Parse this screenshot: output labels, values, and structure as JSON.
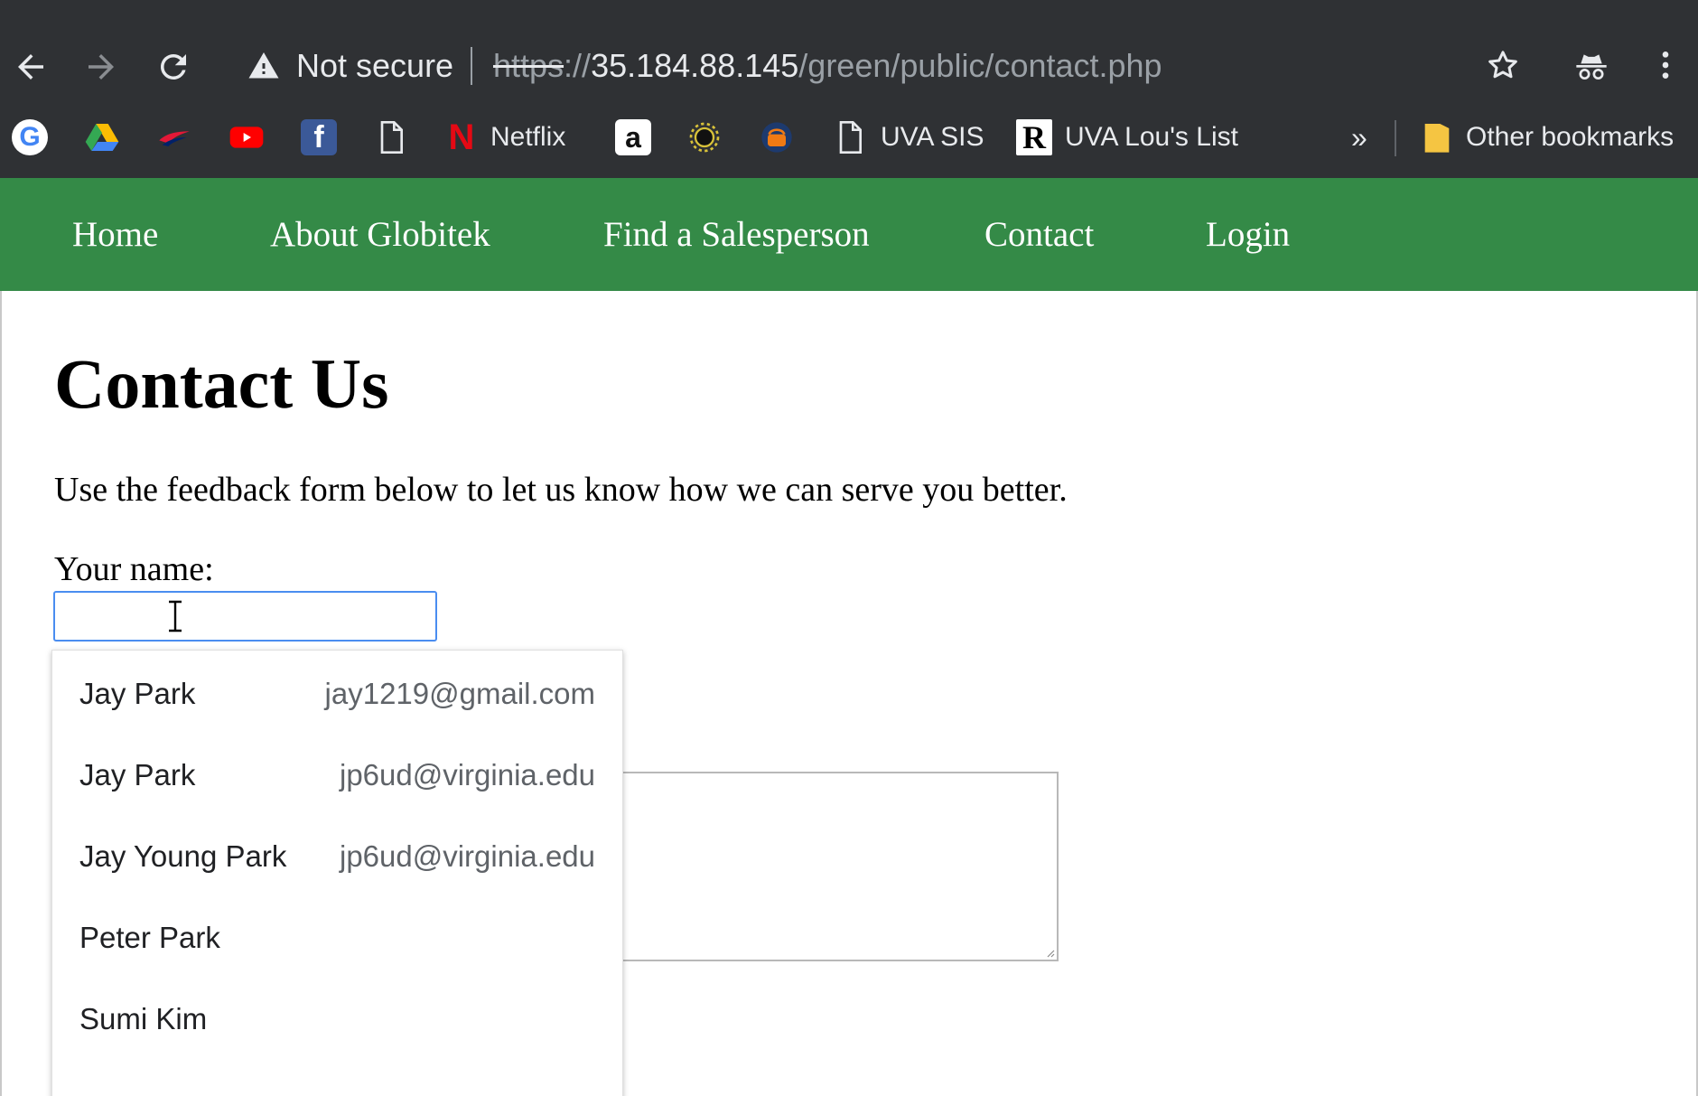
{
  "browser": {
    "security_text": "Not secure",
    "url_scheme": "https",
    "url_sep": "://",
    "url_host": "35.184.88.145",
    "url_path": "/green/public/contact.php",
    "bookmarks": [
      {
        "name": "google",
        "label": ""
      },
      {
        "name": "drive",
        "label": ""
      },
      {
        "name": "bank-of-america",
        "label": ""
      },
      {
        "name": "youtube",
        "label": ""
      },
      {
        "name": "facebook",
        "label": ""
      },
      {
        "name": "page",
        "label": ""
      },
      {
        "name": "netflix",
        "label": "Netflix"
      },
      {
        "name": "amazon",
        "label": ""
      },
      {
        "name": "sun",
        "label": ""
      },
      {
        "name": "basket",
        "label": ""
      },
      {
        "name": "uva-sis",
        "label": "UVA SIS"
      },
      {
        "name": "uva-lous-list",
        "label": "UVA Lou's List"
      }
    ],
    "overflow_label": "»",
    "other_bookmarks_label": "Other bookmarks"
  },
  "nav": {
    "items": [
      "Home",
      "About Globitek",
      "Find a Salesperson",
      "Contact",
      "Login"
    ]
  },
  "page": {
    "title": "Contact Us",
    "intro": "Use the feedback form below to let us know how we can serve you better.",
    "name_label": "Your name:",
    "name_value": ""
  },
  "autofill": {
    "items": [
      {
        "name": "Jay Park",
        "email": "jay1219@gmail.com"
      },
      {
        "name": "Jay Park",
        "email": "jp6ud@virginia.edu"
      },
      {
        "name": "Jay Young Park",
        "email": "jp6ud@virginia.edu"
      },
      {
        "name": "Peter Park",
        "email": ""
      },
      {
        "name": "Sumi Kim",
        "email": ""
      }
    ]
  },
  "colors": {
    "chrome_bg": "#2f3134",
    "nav_green": "#348a47",
    "focus_blue": "#4a8df0"
  }
}
